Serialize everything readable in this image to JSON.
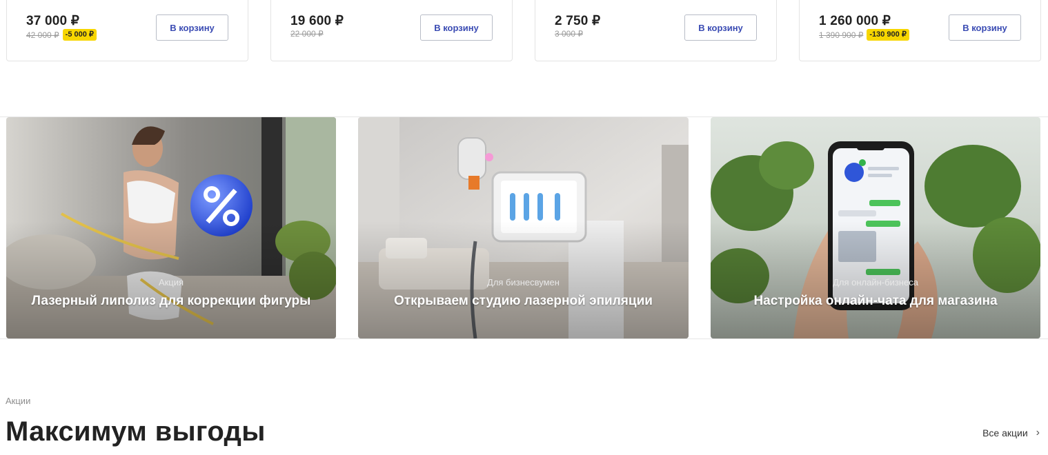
{
  "products": [
    {
      "price": "37 000 ₽",
      "old_price": "42 000 ₽",
      "discount": "-5 000 ₽",
      "button": "В корзину"
    },
    {
      "price": "19 600 ₽",
      "old_price": "22 000 ₽",
      "discount": "",
      "button": "В корзину"
    },
    {
      "price": "2 750 ₽",
      "old_price": "3 000 ₽",
      "discount": "",
      "button": "В корзину"
    },
    {
      "price": "1 260 000 ₽",
      "old_price": "1 390 900 ₽",
      "discount": "-130 900 ₽",
      "button": "В корзину"
    }
  ],
  "banners": [
    {
      "tag": "Акция",
      "title": "Лазерный липолиз для коррекции фигуры"
    },
    {
      "tag": "Для бизнесвумен",
      "title": "Открываем студию лазерной эпиляции"
    },
    {
      "tag": "Для онлайн-бизнеса",
      "title": "Настройка онлайн-чата для магазина"
    }
  ],
  "promo": {
    "eyebrow": "Акции",
    "title": "Максимум выгоды",
    "all_link": "Все акции"
  },
  "colors": {
    "button_text": "#3a4bb3",
    "discount_badge": "#f7d600",
    "border": "#e3e3e3"
  },
  "icons": {
    "all_link_icon": "chevron-right-icon"
  }
}
